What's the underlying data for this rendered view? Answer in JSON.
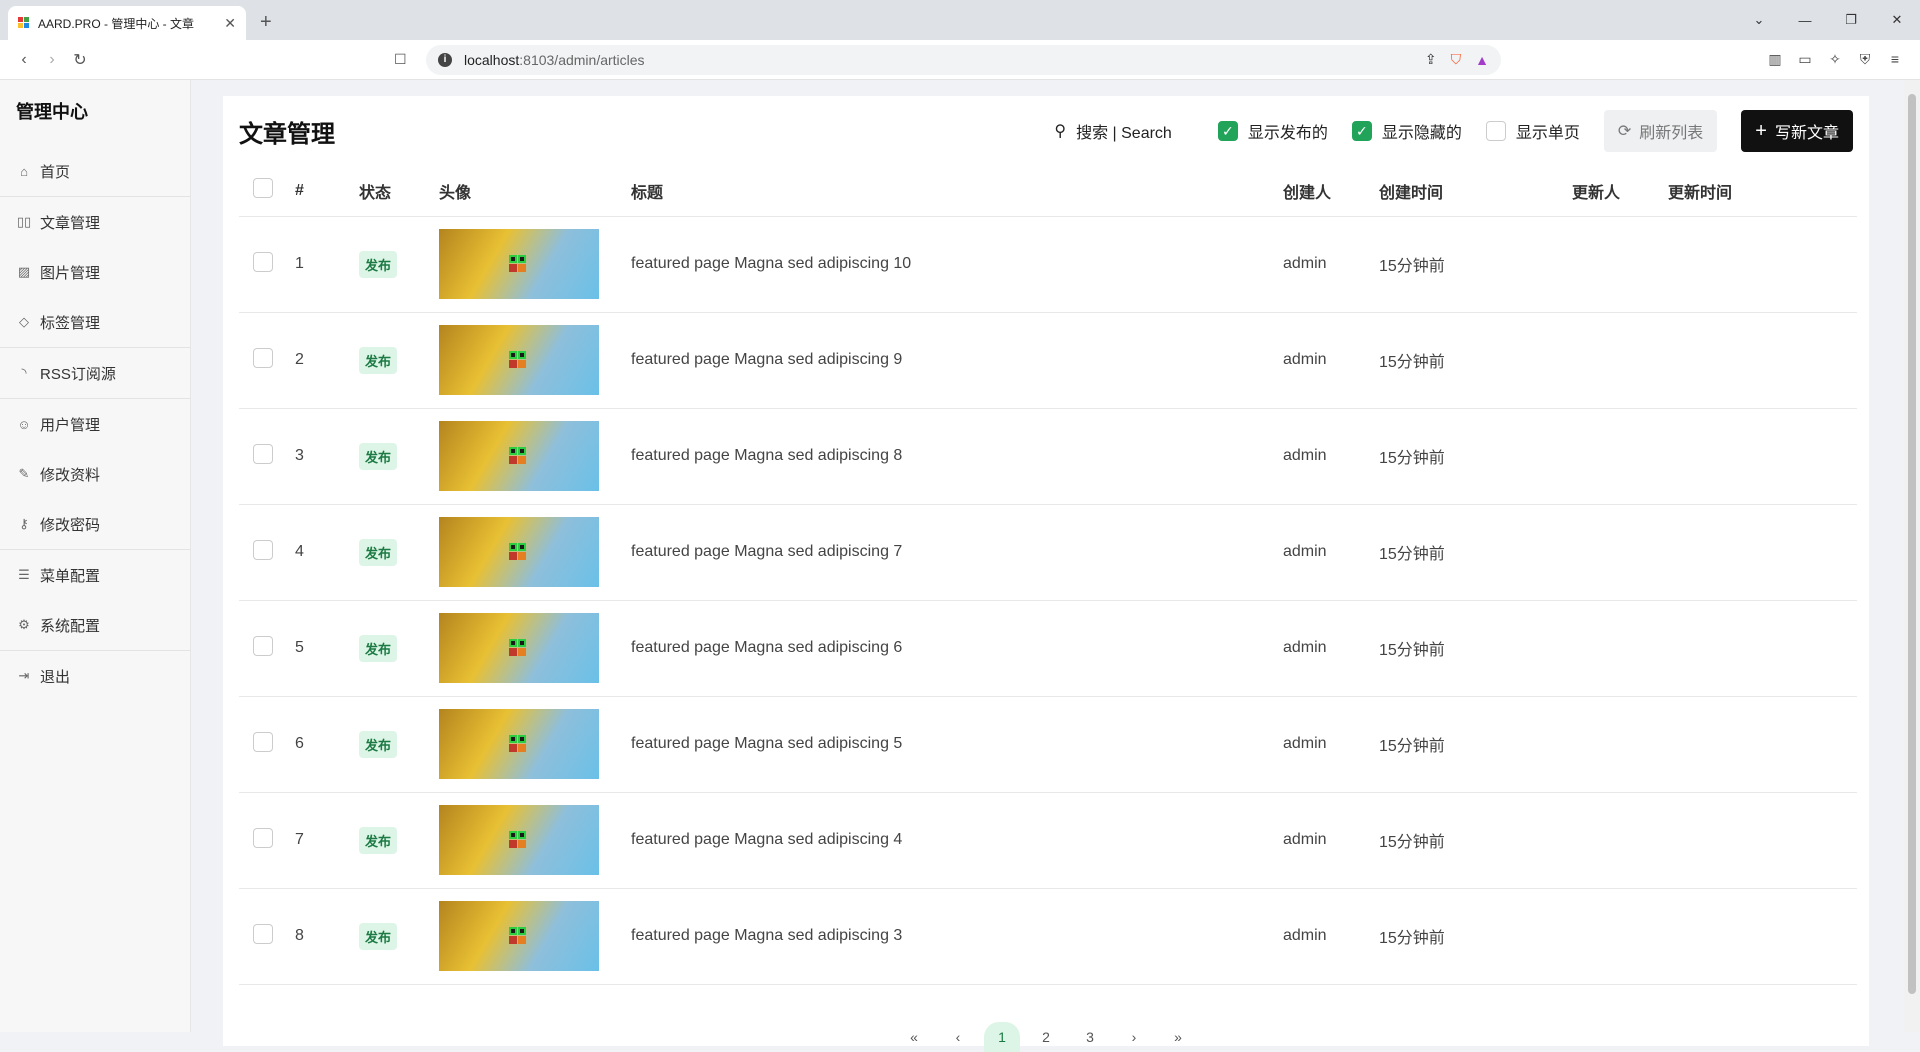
{
  "browser": {
    "tab_title": "AARD.PRO - 管理中心 - 文章",
    "url_host": "localhost",
    "url_path": ":8103/admin/articles"
  },
  "sidebar": {
    "brand": "管理中心",
    "items": [
      {
        "label": "首页",
        "icon": "home-icon"
      },
      {
        "label": "文章管理",
        "icon": "book-icon"
      },
      {
        "label": "图片管理",
        "icon": "image-icon"
      },
      {
        "label": "标签管理",
        "icon": "tag-icon"
      },
      {
        "label": "RSS订阅源",
        "icon": "rss-icon"
      },
      {
        "label": "用户管理",
        "icon": "users-icon"
      },
      {
        "label": "修改资料",
        "icon": "user-edit-icon"
      },
      {
        "label": "修改密码",
        "icon": "key-icon"
      },
      {
        "label": "菜单配置",
        "icon": "list-icon"
      },
      {
        "label": "系统配置",
        "icon": "gear-icon"
      },
      {
        "label": "退出",
        "icon": "logout-icon"
      }
    ]
  },
  "header": {
    "title": "文章管理",
    "search_label": "搜索 | Search",
    "show_published": "显示发布的",
    "show_hidden": "显示隐藏的",
    "show_single": "显示单页",
    "refresh": "刷新列表",
    "new_article": "写新文章"
  },
  "table": {
    "columns": [
      "#",
      "状态",
      "头像",
      "标题",
      "创建人",
      "创建时间",
      "更新人",
      "更新时间"
    ],
    "rows": [
      {
        "id": "1",
        "status": "发布",
        "title": "featured page Magna sed adipiscing 10",
        "creator": "admin",
        "created": "15分钟前",
        "updater": "",
        "updated": ""
      },
      {
        "id": "2",
        "status": "发布",
        "title": "featured page Magna sed adipiscing 9",
        "creator": "admin",
        "created": "15分钟前",
        "updater": "",
        "updated": ""
      },
      {
        "id": "3",
        "status": "发布",
        "title": "featured page Magna sed adipiscing 8",
        "creator": "admin",
        "created": "15分钟前",
        "updater": "",
        "updated": ""
      },
      {
        "id": "4",
        "status": "发布",
        "title": "featured page Magna sed adipiscing 7",
        "creator": "admin",
        "created": "15分钟前",
        "updater": "",
        "updated": ""
      },
      {
        "id": "5",
        "status": "发布",
        "title": "featured page Magna sed adipiscing 6",
        "creator": "admin",
        "created": "15分钟前",
        "updater": "",
        "updated": ""
      },
      {
        "id": "6",
        "status": "发布",
        "title": "featured page Magna sed adipiscing 5",
        "creator": "admin",
        "created": "15分钟前",
        "updater": "",
        "updated": ""
      },
      {
        "id": "7",
        "status": "发布",
        "title": "featured page Magna sed adipiscing 4",
        "creator": "admin",
        "created": "15分钟前",
        "updater": "",
        "updated": ""
      },
      {
        "id": "8",
        "status": "发布",
        "title": "featured page Magna sed adipiscing 3",
        "creator": "admin",
        "created": "15分钟前",
        "updater": "",
        "updated": ""
      }
    ]
  },
  "pagination": {
    "first": "«",
    "prev": "‹",
    "pages": [
      "1",
      "2",
      "3"
    ],
    "current": "1",
    "next": "›",
    "last": "»"
  },
  "colors": {
    "accent_green": "#22a35a",
    "badge_bg": "#dcf5e6",
    "primary_button": "#111111"
  }
}
